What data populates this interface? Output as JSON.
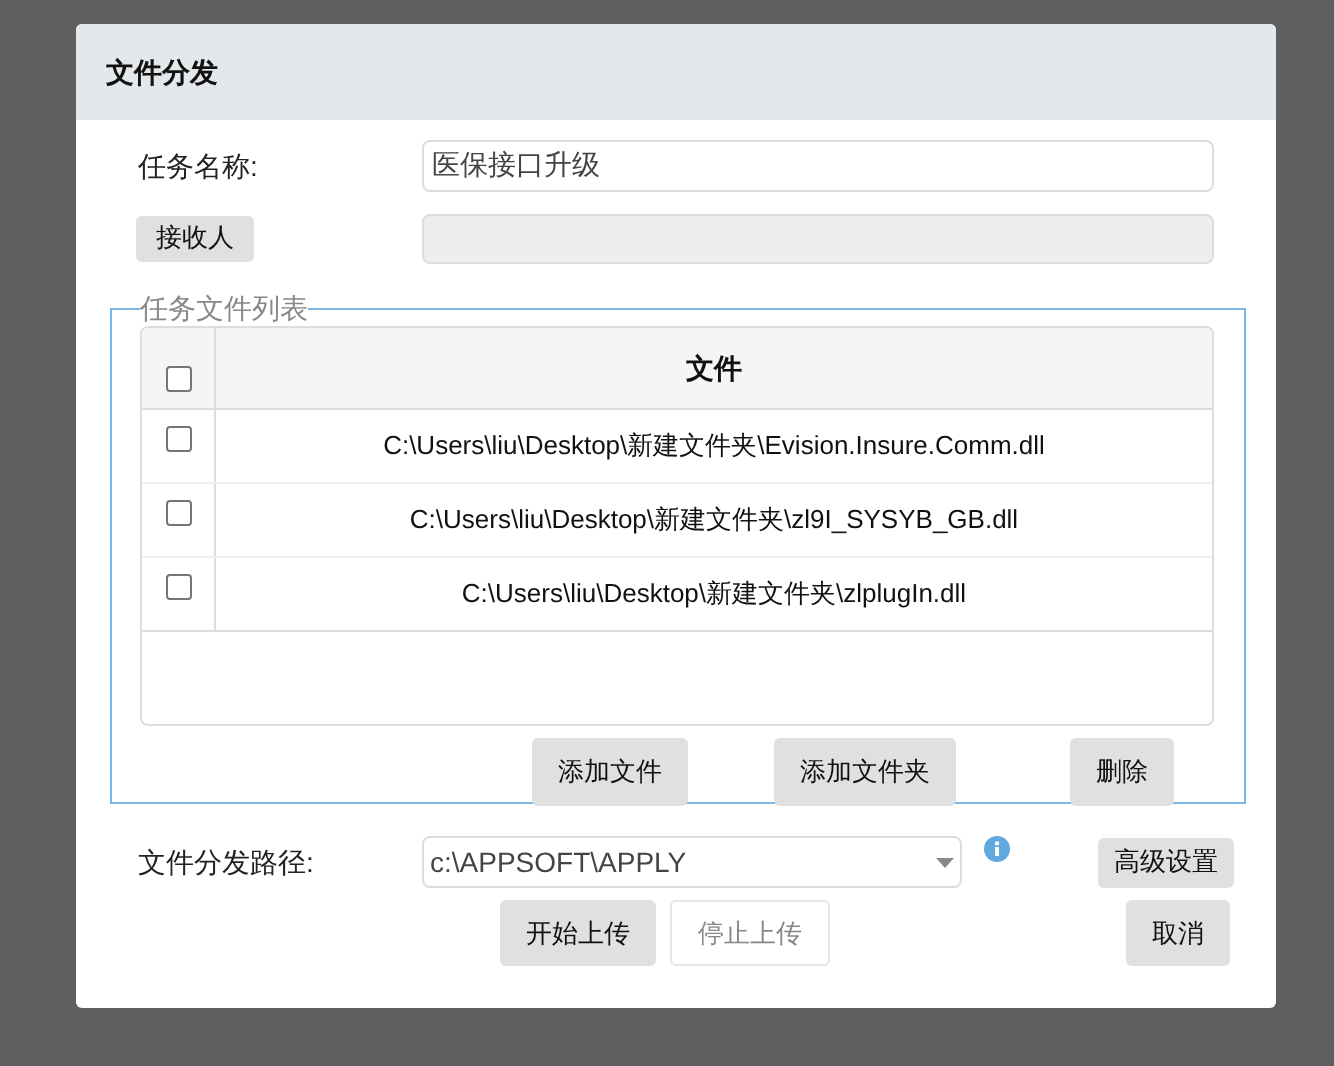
{
  "dialog": {
    "title": "文件分发"
  },
  "task_name": {
    "label": "任务名称:",
    "value": "医保接口升级"
  },
  "recipient": {
    "button": "接收人"
  },
  "file_list": {
    "legend": "任务文件列表",
    "select_all": {
      "checked": false
    },
    "column": "文件",
    "rows": [
      {
        "path": "C:\\Users\\liu\\Desktop\\新建文件夹\\Evision.Insure.Comm.dll",
        "checked": false
      },
      {
        "path": "C:\\Users\\liu\\Desktop\\新建文件夹\\zl9I_SYSYB_GB.dll",
        "checked": false
      },
      {
        "path": "C:\\Users\\liu\\Desktop\\新建文件夹\\zlplugIn.dll",
        "checked": false
      }
    ],
    "buttons": [
      "添加文件",
      "添加文件夹",
      "删除"
    ]
  },
  "path": {
    "label": "文件分发路径:",
    "value": "c:\\APPSOFT\\APPLY",
    "advanced": "高级设置"
  },
  "actions": [
    {
      "label": "开始上传",
      "disabled": false
    },
    {
      "label": "停止上传",
      "disabled": true
    },
    {
      "label": "取消",
      "disabled": false
    }
  ]
}
